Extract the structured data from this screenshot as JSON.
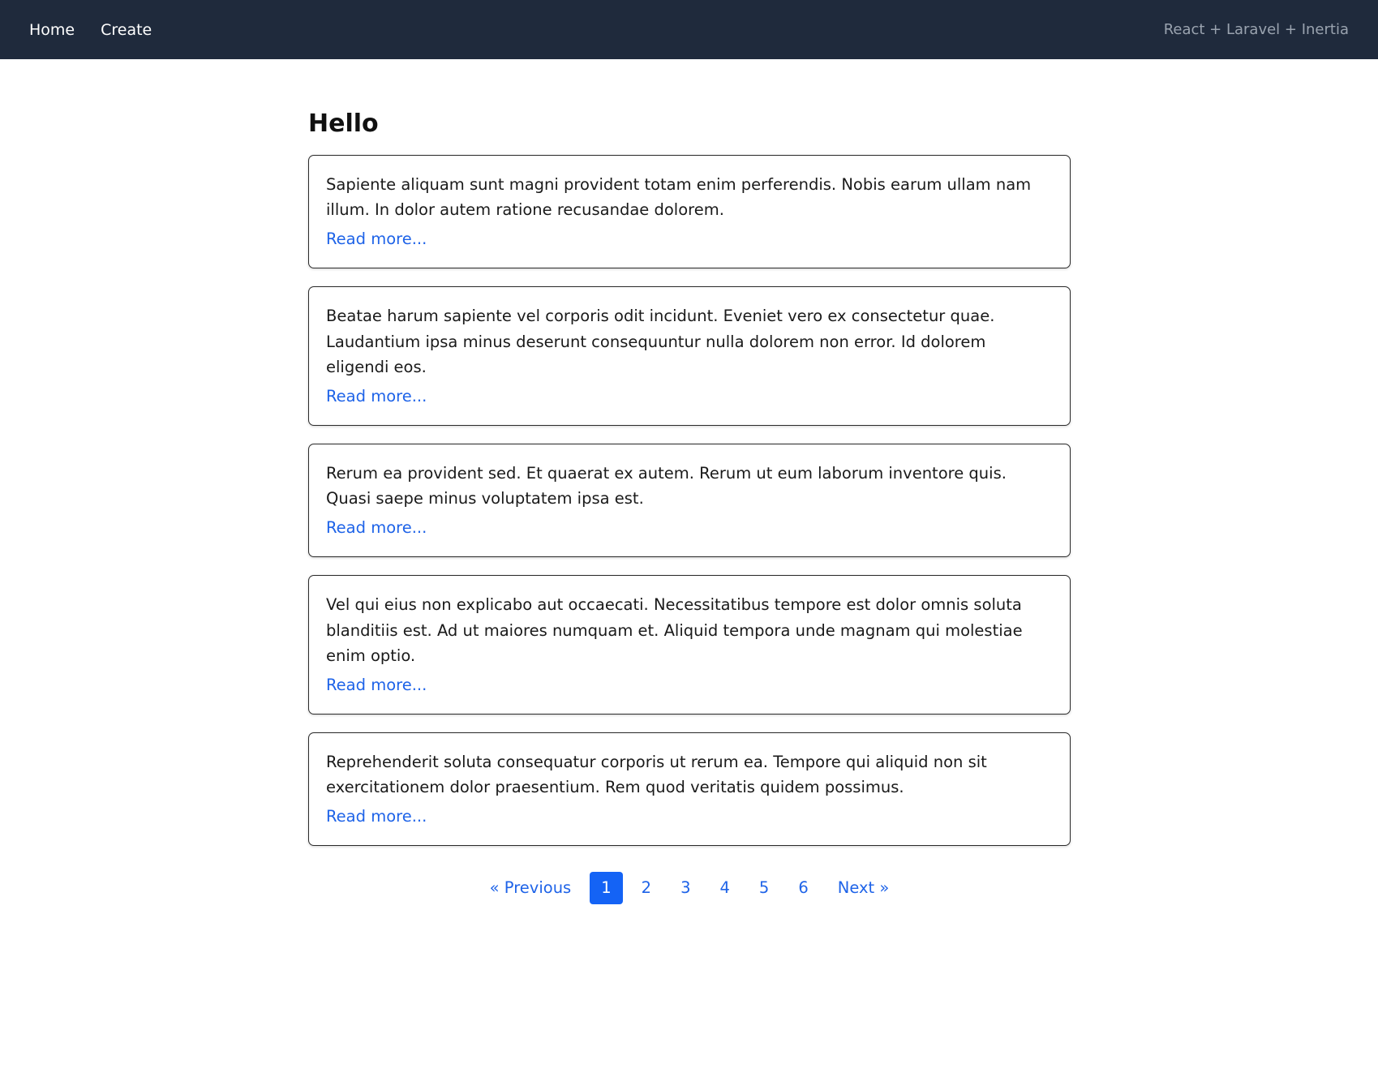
{
  "navbar": {
    "links": [
      {
        "label": "Home"
      },
      {
        "label": "Create"
      }
    ],
    "brand": "React + Laravel + Inertia"
  },
  "main": {
    "title": "Hello",
    "posts": [
      {
        "body": "Sapiente aliquam sunt magni provident totam enim perferendis. Nobis earum ullam nam illum. In dolor autem ratione recusandae dolorem.",
        "read_more": "Read more..."
      },
      {
        "body": "Beatae harum sapiente vel corporis odit incidunt. Eveniet vero ex consectetur quae. Laudantium ipsa minus deserunt consequuntur nulla dolorem non error. Id dolorem eligendi eos.",
        "read_more": "Read more..."
      },
      {
        "body": "Rerum ea provident sed. Et quaerat ex autem. Rerum ut eum laborum inventore quis. Quasi saepe minus voluptatem ipsa est.",
        "read_more": "Read more..."
      },
      {
        "body": "Vel qui eius non explicabo aut occaecati. Necessitatibus tempore est dolor omnis soluta blanditiis est. Ad ut maiores numquam et. Aliquid tempora unde magnam qui molestiae enim optio.",
        "read_more": "Read more..."
      },
      {
        "body": "Reprehenderit soluta consequatur corporis ut rerum ea. Tempore qui aliquid non sit exercitationem dolor praesentium. Rem quod veritatis quidem possimus.",
        "read_more": "Read more..."
      }
    ]
  },
  "pagination": {
    "previous_label": "« Previous",
    "next_label": "Next »",
    "pages": [
      "1",
      "2",
      "3",
      "4",
      "5",
      "6"
    ],
    "current_page": "1",
    "active_color": "#1463f5"
  },
  "colors": {
    "navbar_bg": "#1f2a3c",
    "link": "#1e63e8"
  }
}
